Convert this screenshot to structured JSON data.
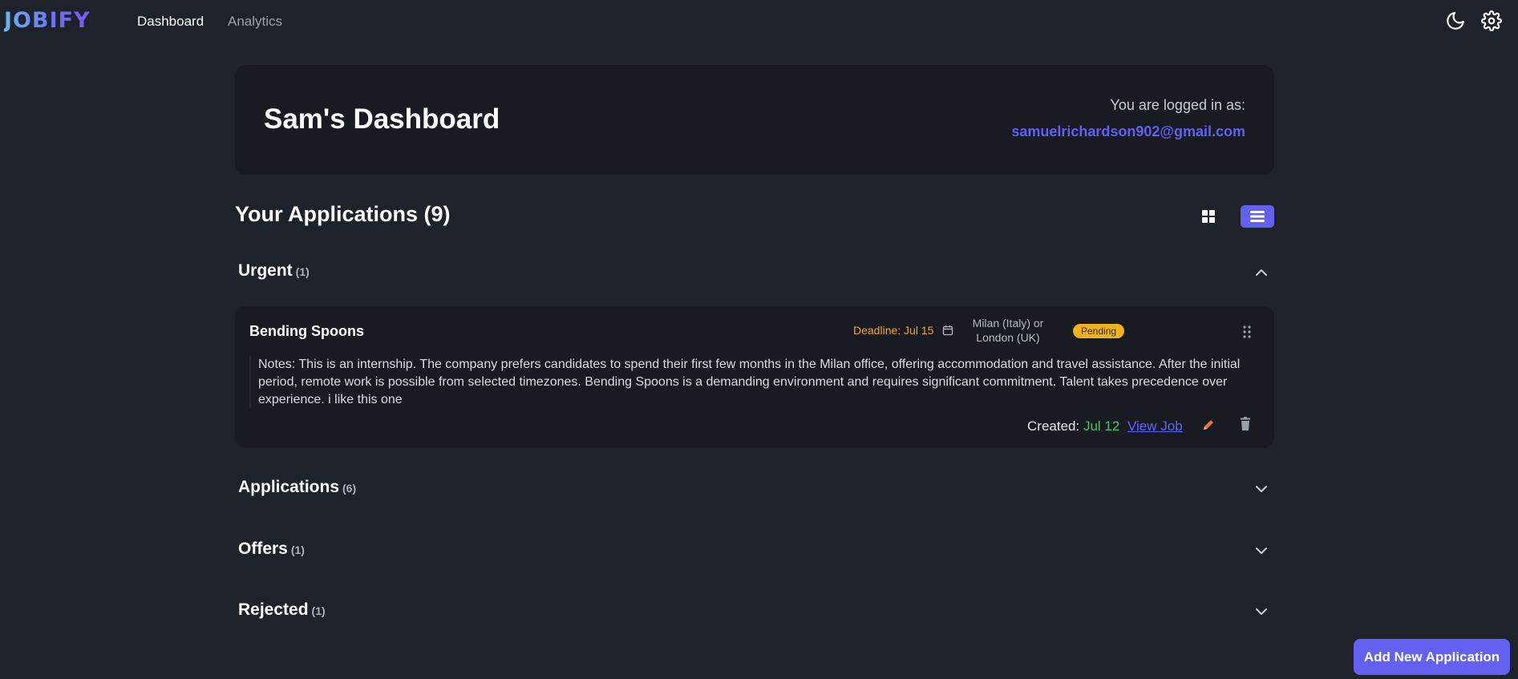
{
  "nav": {
    "logo": "JOBIFY",
    "links": [
      {
        "label": "Dashboard",
        "active": true
      },
      {
        "label": "Analytics",
        "active": false
      }
    ],
    "icons": [
      "moon-icon",
      "gear-icon"
    ]
  },
  "header": {
    "title": "Sam's Dashboard",
    "logged_label": "You are logged in as:",
    "email": "samuelrichardson902@gmail.com"
  },
  "applications": {
    "heading": "Your Applications (9)",
    "view_modes": [
      "grid",
      "list"
    ],
    "active_view": "list"
  },
  "sections": [
    {
      "title": "Urgent",
      "count": "(1)",
      "expanded": true
    },
    {
      "title": "Applications",
      "count": "(6)",
      "expanded": false
    },
    {
      "title": "Offers",
      "count": "(1)",
      "expanded": false
    },
    {
      "title": "Rejected",
      "count": "(1)",
      "expanded": false
    }
  ],
  "urgent_card": {
    "company": "Bending Spoons",
    "deadline": "Deadline: Jul 15",
    "location_line1": "Milan (Italy) or",
    "location_line2": "London (UK)",
    "status": "Pending",
    "notes": "Notes: This is an internship. The company prefers candidates to spend their first few months in the Milan office, offering accommodation and travel assistance. After the initial period, remote work is possible from selected timezones. Bending Spoons is a demanding environment and requires significant commitment. Talent takes precedence over experience. i like this one",
    "created_label": "Created:",
    "created_date": "Jul 12",
    "view_job": "View Job"
  },
  "fab": {
    "label": "Add New Application"
  },
  "colors": {
    "background": "#1e222b",
    "card": "#181b22",
    "accent": "#6361f2",
    "deadline": "#f5a524",
    "pending": "#f0b21a",
    "created": "#3fc66a"
  }
}
